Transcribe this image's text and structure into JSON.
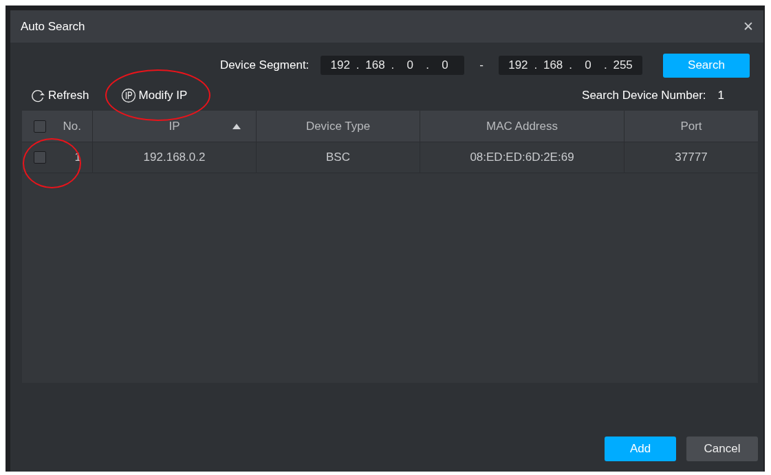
{
  "window": {
    "title": "Auto Search",
    "close": "✕"
  },
  "segment": {
    "label": "Device Segment:",
    "separator": ".",
    "range_separator": "-",
    "start": [
      "192",
      "168",
      "0",
      "0"
    ],
    "end": [
      "192",
      "168",
      "0",
      "255"
    ],
    "button": "Search"
  },
  "toolbar": [
    {
      "kind": "refresh",
      "label": "Refresh",
      "highlighted": false
    },
    {
      "kind": "ip",
      "label": "Modify IP",
      "highlighted": true
    }
  ],
  "device_count": {
    "label": "Search Device Number:",
    "value": "1"
  },
  "table": {
    "header_checked": false,
    "columns": [
      {
        "label": "No.",
        "sorted": false
      },
      {
        "label": "IP",
        "sorted": true
      },
      {
        "label": "Device Type",
        "sorted": false
      },
      {
        "label": "MAC Address",
        "sorted": false
      },
      {
        "label": "Port",
        "sorted": false
      }
    ],
    "rows": [
      {
        "checked": false,
        "highlighted": true,
        "cells": [
          "1",
          "192.168.0.2",
          "BSC",
          "08:ED:ED:6D:2E:69",
          "37777"
        ]
      }
    ]
  },
  "buttons": [
    {
      "kind": "primary",
      "label": "Add"
    },
    {
      "kind": "secondary",
      "label": "Cancel"
    }
  ]
}
